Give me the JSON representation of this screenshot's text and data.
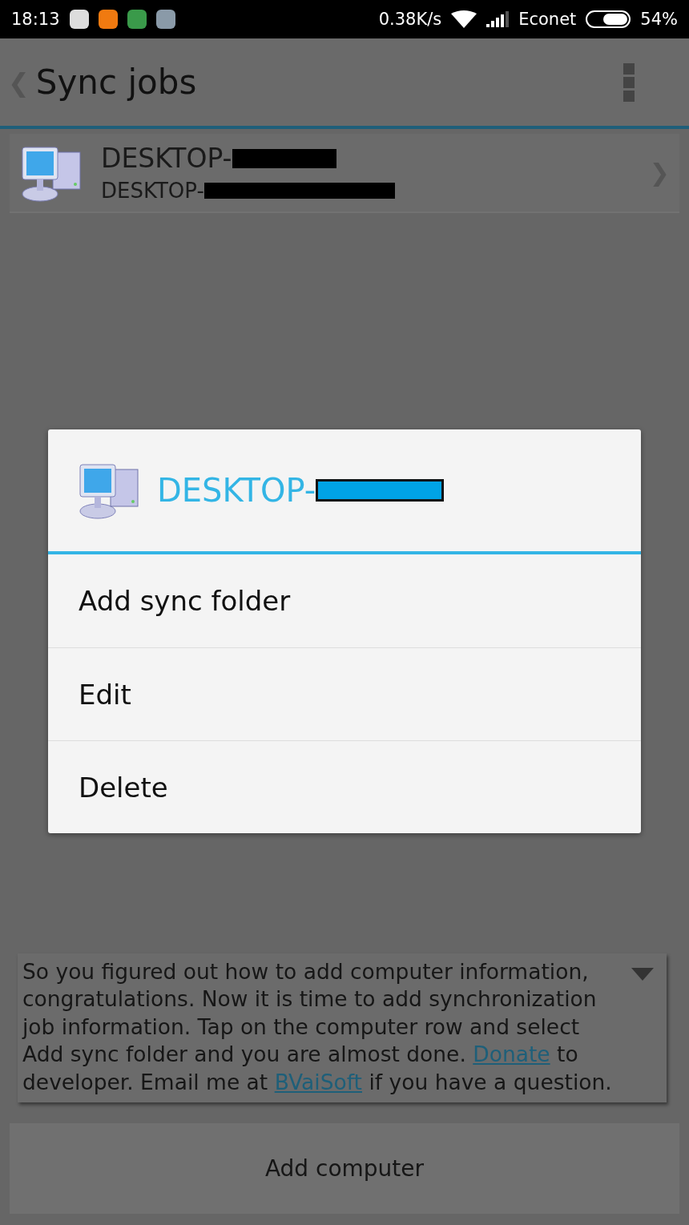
{
  "status_bar": {
    "time": "18:13",
    "speed": "0.38K/s",
    "carrier": "Econet",
    "battery": "54%"
  },
  "app_bar": {
    "back": "❮",
    "title": "Sync jobs"
  },
  "computers": [
    {
      "name": "DESKTOP-",
      "path": "DESKTOP-",
      "chevron": "❯"
    }
  ],
  "tip": {
    "parts": [
      {
        "kind": "text",
        "text": "So you figured out how to add computer information, congratulations. Now it is time to add synchronization job information. Tap on the computer row and select Add sync folder and you are almost done. "
      },
      {
        "kind": "link",
        "text": "Donate"
      },
      {
        "kind": "text",
        "text": " to developer. Email me at "
      },
      {
        "kind": "link",
        "text": "BVaiSoft"
      },
      {
        "kind": "text",
        "text": " if you have a question."
      }
    ]
  },
  "add_button": "Add computer",
  "dialog": {
    "title": "DESKTOP-",
    "items": [
      "Add sync folder",
      "Edit",
      "Delete"
    ]
  }
}
